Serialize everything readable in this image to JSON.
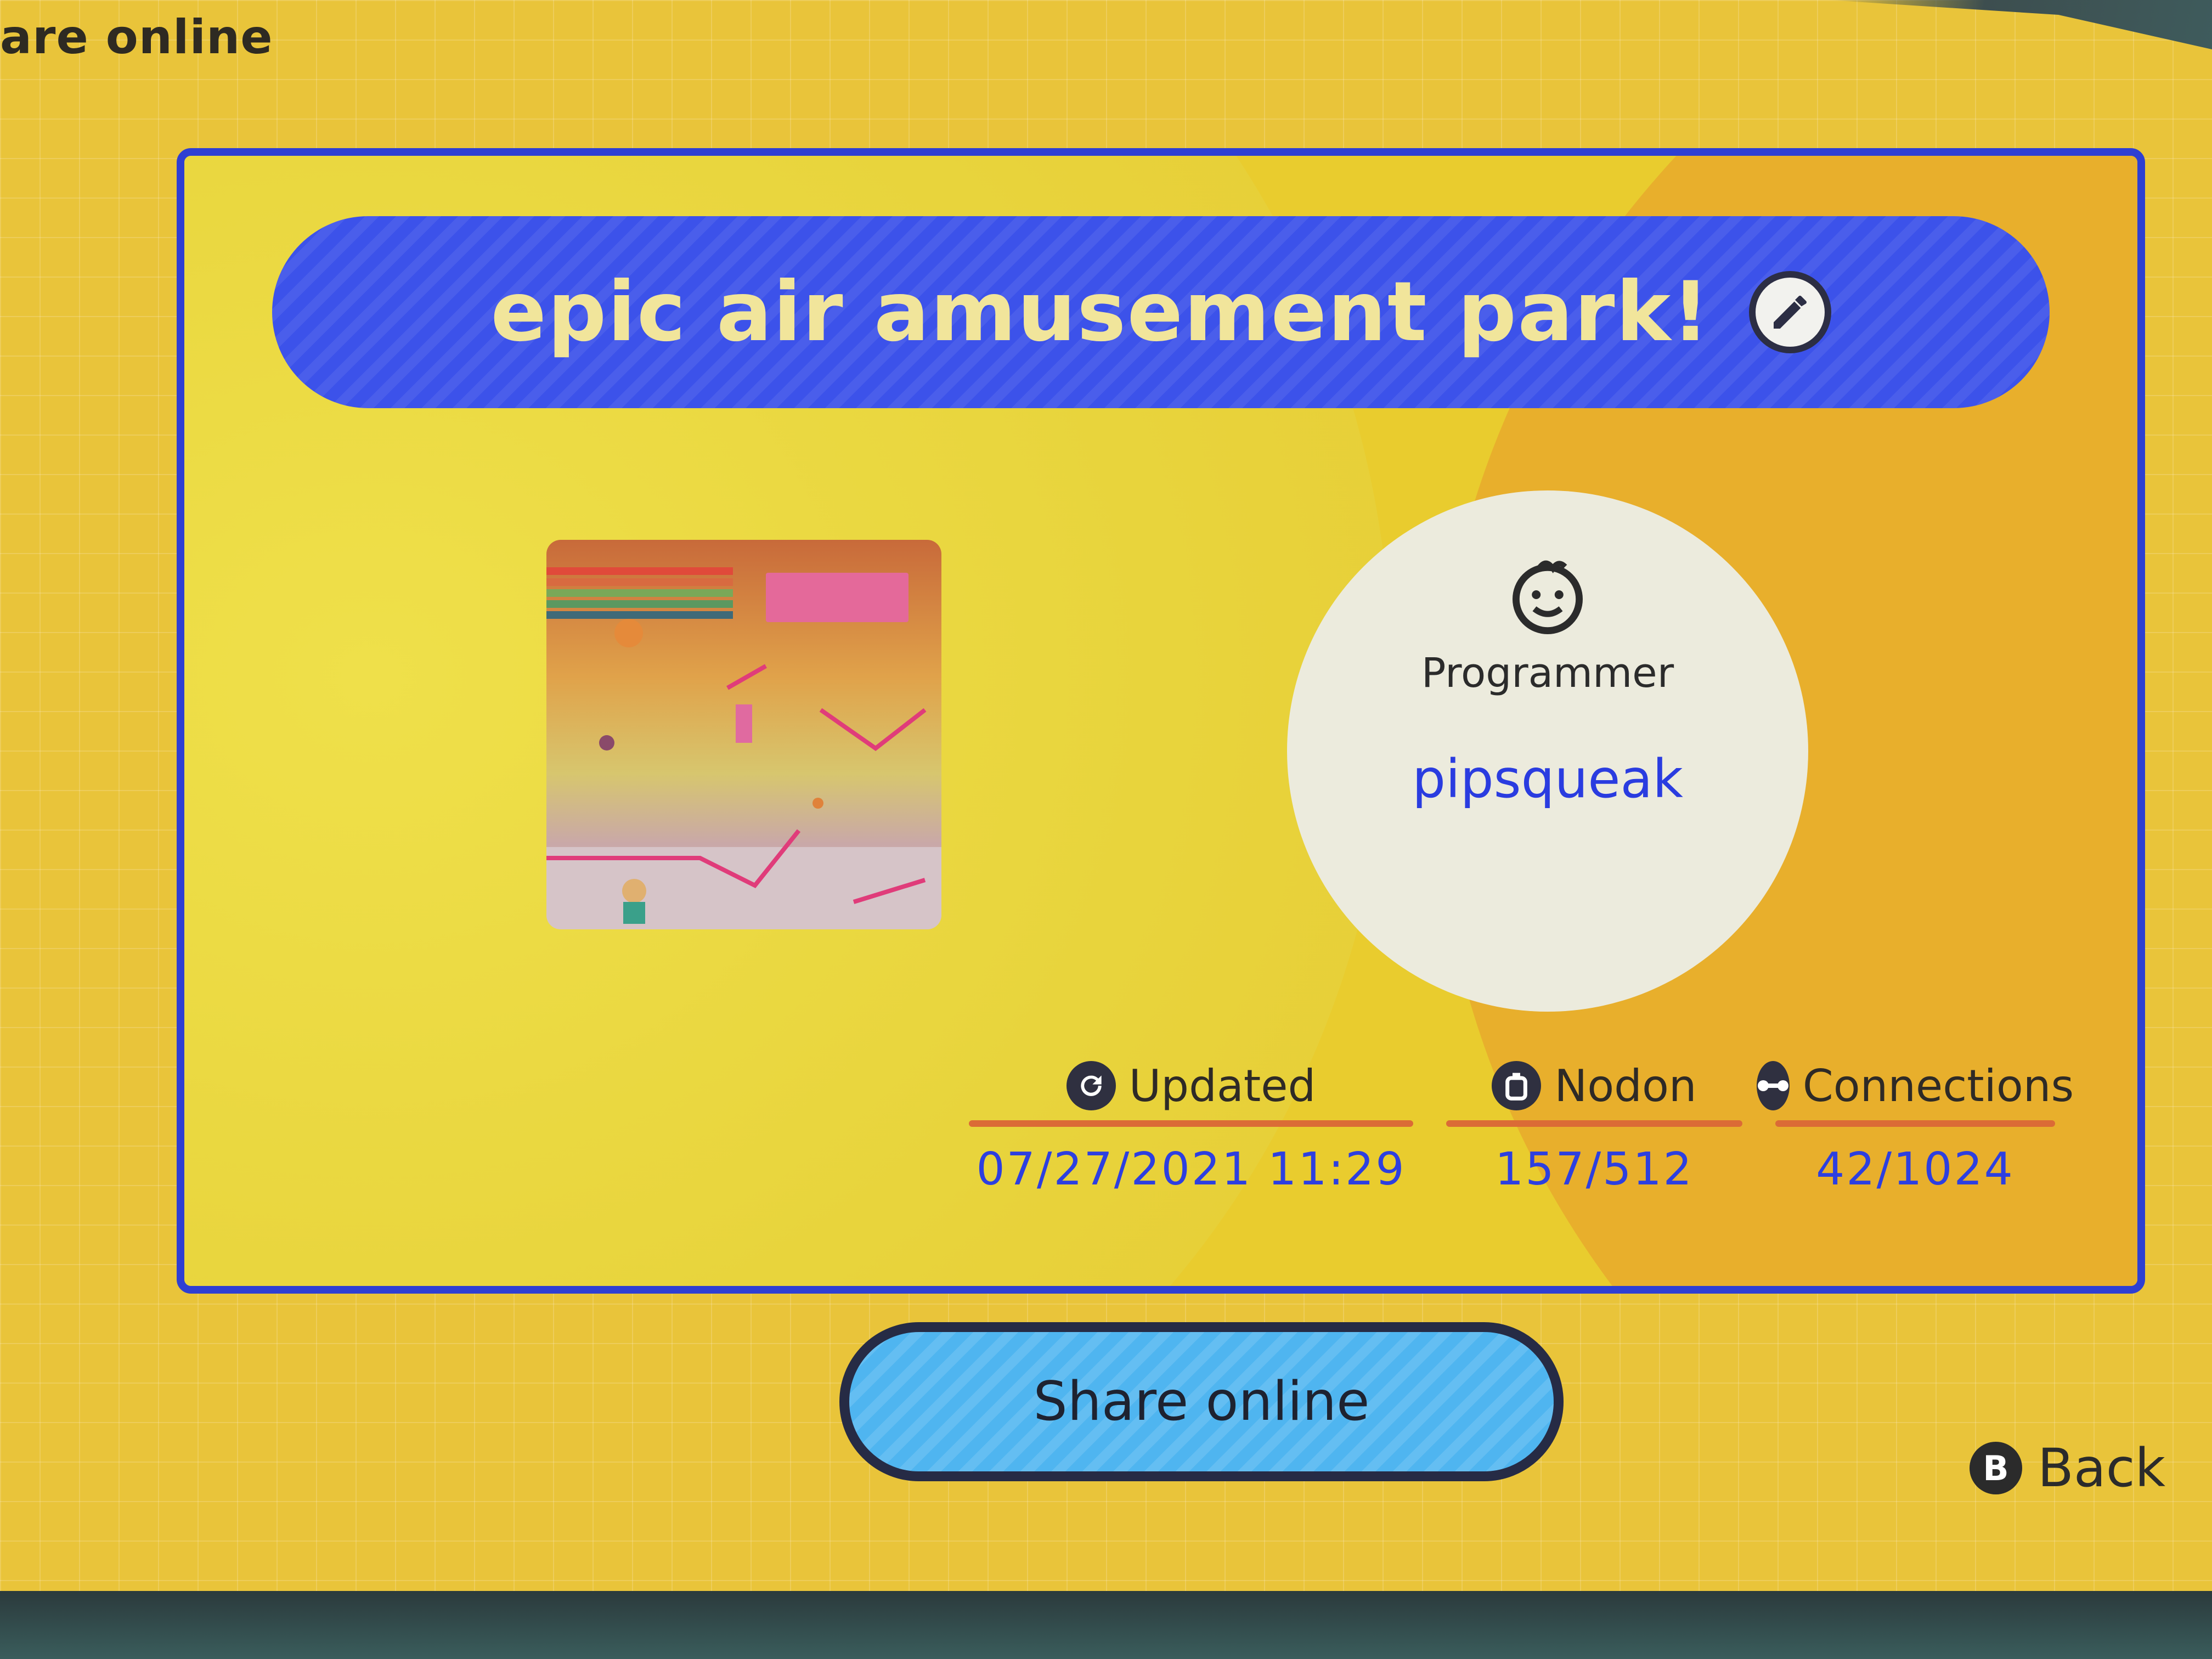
{
  "header": {
    "title": "are online"
  },
  "program": {
    "title": "epic air amusement park!",
    "programmer_label": "Programmer",
    "programmer_name": "pipsqueak"
  },
  "stats": [
    {
      "icon": "refresh-icon",
      "label": "Updated",
      "value": "07/27/2021 11:29"
    },
    {
      "icon": "nodon-icon",
      "label": "Nodon",
      "value": "157/512"
    },
    {
      "icon": "connection-icon",
      "label": "Connections",
      "value": "42/1024"
    }
  ],
  "actions": {
    "share_label": "Share online",
    "back_button_glyph": "B",
    "back_label": "Back"
  },
  "colors": {
    "background": "#e9c43a",
    "panel_border": "#2f3fd2",
    "title_bar": "#3c52ea",
    "title_text": "#f1e59b",
    "value_text": "#2d3fe0",
    "share_button": "#4fb5f0",
    "rule": "#db6b36"
  }
}
